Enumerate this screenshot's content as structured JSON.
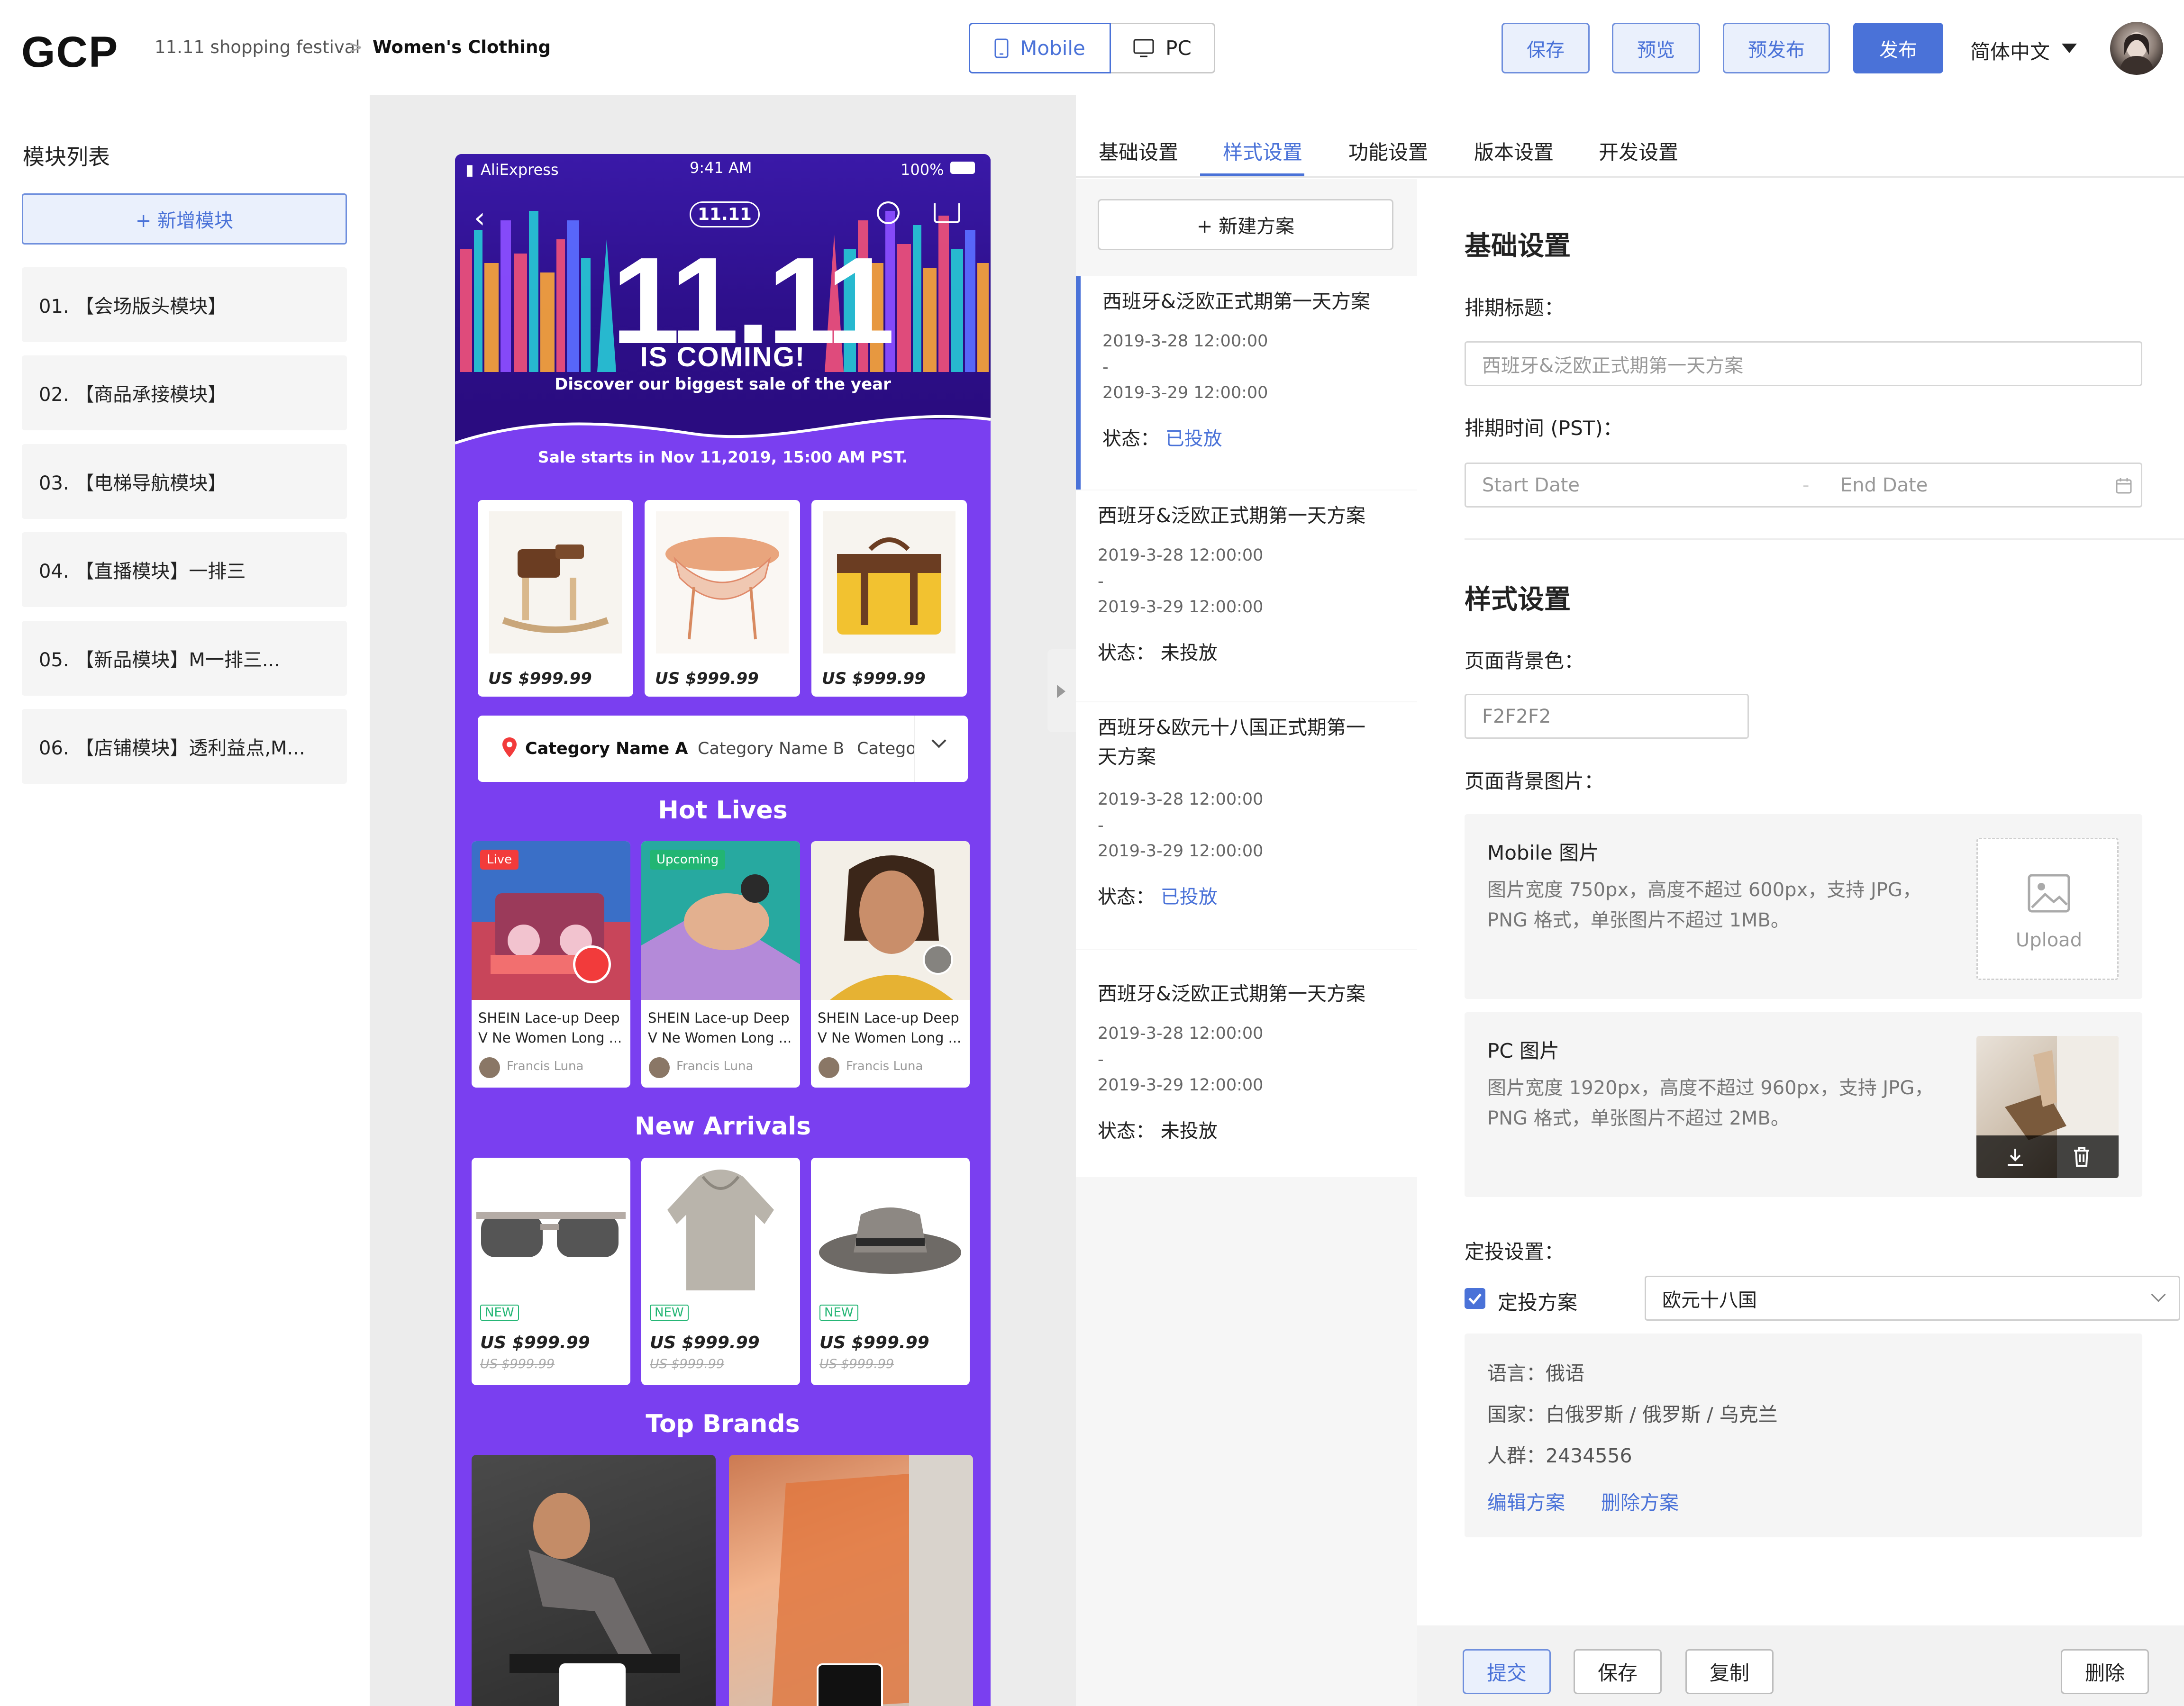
{
  "header": {
    "logo": "GCP",
    "breadcrumb": [
      "11.11 shopping festival",
      "Women's Clothing"
    ],
    "breadcrumb_sep": ">",
    "view_toggle": {
      "mobile": "Mobile",
      "pc": "PC",
      "selected": "Mobile"
    },
    "actions": {
      "save": "保存",
      "preview": "预览",
      "prepublish": "预发布",
      "publish": "发布"
    },
    "language": "简体中文"
  },
  "sidebar": {
    "title": "模块列表",
    "add_label": "+ 新增模块",
    "items": [
      "01. 【会场版头模块】",
      "02. 【商品承接模块】",
      "03. 【电梯导航模块】",
      "04. 【直播模块】一排三",
      "05. 【新品模块】M一排三...",
      "06. 【店铺模块】透利益点,M..."
    ]
  },
  "preview": {
    "status_bar": {
      "carrier": "AliExpress",
      "time": "9:41 AM",
      "battery": "100%"
    },
    "hero": {
      "logo": "11.11",
      "big": "11.11",
      "coming": "IS COMING!",
      "tagline": "Discover our biggest sale of the year"
    },
    "sale_starts": "Sale starts in Nov 11,2019, 15:00 AM PST.",
    "products": [
      {
        "price": "US $999.99",
        "icon": "rocking-horse"
      },
      {
        "price": "US $999.99",
        "icon": "side-table"
      },
      {
        "price": "US $999.99",
        "icon": "yellow-bag"
      }
    ],
    "categories": [
      "Category Name A",
      "Category Name B",
      "Catego"
    ],
    "hot_lives": {
      "title": "Hot Lives",
      "items": [
        {
          "badge": "Live",
          "title": "SHEIN Lace-up Deep V Ne Women Long ...",
          "author": "Francis Luna"
        },
        {
          "badge": "Upcoming",
          "title": "SHEIN Lace-up Deep V Ne Women Long ...",
          "author": "Francis Luna"
        },
        {
          "badge": "",
          "title": "SHEIN Lace-up Deep V Ne Women Long ...",
          "author": "Francis Luna"
        }
      ]
    },
    "new_arrivals": {
      "title": "New Arrivals",
      "items": [
        {
          "badge": "NEW",
          "price": "US $999.99",
          "old_price": "US $999.99",
          "icon": "sunglasses"
        },
        {
          "badge": "NEW",
          "price": "US $999.99",
          "old_price": "US $999.99",
          "icon": "hoodie"
        },
        {
          "badge": "NEW",
          "price": "US $999.99",
          "old_price": "US $999.99",
          "icon": "hat"
        }
      ]
    },
    "top_brands": {
      "title": "Top Brands"
    }
  },
  "right": {
    "tabs": [
      "基础设置",
      "样式设置",
      "功能设置",
      "版本设置",
      "开发设置"
    ],
    "active_tab": "样式设置",
    "new_plan": "+ 新建方案",
    "plans": [
      {
        "title": "西班牙&泛欧正式期第一天方案",
        "start": "2019-3-28 12:00:00",
        "sep": "-",
        "end": "2019-3-29 12:00:00",
        "status_label": "状态：",
        "status": "已投放",
        "selected": true
      },
      {
        "title": "西班牙&泛欧正式期第一天方案",
        "start": "2019-3-28 12:00:00",
        "sep": "-",
        "end": "2019-3-29 12:00:00",
        "status_label": "状态：",
        "status": "未投放",
        "selected": false
      },
      {
        "title": "西班牙&欧元十八国正式期第一天方案",
        "start": "2019-3-28 12:00:00",
        "sep": "-",
        "end": "2019-3-29 12:00:00",
        "status_label": "状态：",
        "status": "已投放",
        "selected": false
      },
      {
        "title": "西班牙&泛欧正式期第一天方案",
        "start": "2019-3-28 12:00:00",
        "sep": "-",
        "end": "2019-3-29 12:00:00",
        "status_label": "状态：",
        "status": "未投放",
        "selected": false
      }
    ],
    "form": {
      "basic_title": "基础设置",
      "schedule_title_label": "排期标题：",
      "schedule_title_value": "西班牙&泛欧正式期第一天方案",
      "schedule_time_label": "排期时间 (PST)：",
      "start_placeholder": "Start Date",
      "date_sep": "-",
      "end_placeholder": "End Date",
      "style_title": "样式设置",
      "bg_color_label": "页面背景色：",
      "bg_color_value": "F2F2F2",
      "bg_image_label": "页面背景图片：",
      "mobile_image": {
        "title": "Mobile 图片",
        "desc": "图片宽度 750px，高度不超过 600px，支持 JPG，PNG 格式，单张图片不超过 1MB。",
        "upload": "Upload"
      },
      "pc_image": {
        "title": "PC 图片",
        "desc": "图片宽度 1920px，高度不超过 960px，支持 JPG，PNG 格式，单张图片不超过 2MB。"
      },
      "targeting_label": "定投设置：",
      "targeting_checkbox": "定投方案",
      "targeting_checked": true,
      "targeting_select": "欧元十八国",
      "details": {
        "language": {
          "label": "语言：",
          "value": "俄语"
        },
        "country": {
          "label": "国家：",
          "value": "白俄罗斯 / 俄罗斯 / 乌克兰"
        },
        "crowd": {
          "label": "人群：",
          "value": "2434556"
        },
        "edit": "编辑方案",
        "delete": "删除方案"
      }
    },
    "footer": {
      "submit": "提交",
      "save": "保存",
      "copy": "复制",
      "delete": "删除"
    }
  },
  "colors": {
    "accent": "#4a72d8",
    "preview_bg": "#7a3ff0",
    "live_badge": "#f23b3b",
    "upcoming_badge": "#22b573"
  }
}
